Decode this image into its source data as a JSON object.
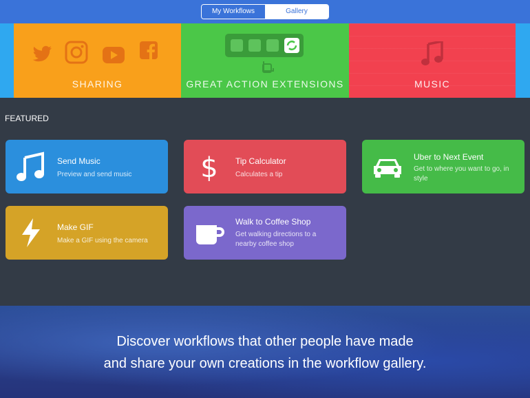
{
  "topbar": {
    "tabs": [
      {
        "label": "My Workflows",
        "active": true
      },
      {
        "label": "Gallery",
        "active": false
      }
    ]
  },
  "banner": [
    {
      "label": "SHARING",
      "color": "#f9a01b",
      "icons": [
        "twitter-icon",
        "instagram-icon",
        "youtube-icon",
        "facebook-icon"
      ]
    },
    {
      "label": "GREAT ACTION EXTENSIONS",
      "color": "#4bc748",
      "icons": [
        "action-extension-icon"
      ]
    },
    {
      "label": "MUSIC",
      "color": "#f2414f",
      "icons": [
        "music-note-icon"
      ]
    }
  ],
  "featured": {
    "heading": "FEATURED",
    "cards": [
      {
        "title": "Send Music",
        "subtitle": "Preview and send music",
        "color": "#2b8fdd",
        "icon": "music-note-icon"
      },
      {
        "title": "Tip Calculator",
        "subtitle": "Calculates a tip",
        "color": "#e24c57",
        "icon": "dollar-icon"
      },
      {
        "title": "Uber to Next Event",
        "subtitle": "Get to where you want to go, in style",
        "color": "#45bb48",
        "icon": "car-icon"
      },
      {
        "title": "Make GIF",
        "subtitle": "Make a GIF using the camera",
        "color": "#d5a327",
        "icon": "lightning-icon"
      },
      {
        "title": "Walk to Coffee Shop",
        "subtitle": "Get walking directions to a nearby coffee shop",
        "color": "#7b68cc",
        "icon": "coffee-cup-icon"
      }
    ]
  },
  "promo": {
    "line1": "Discover workflows that other people have made",
    "line2": "and share your own creations in the workflow gallery."
  }
}
